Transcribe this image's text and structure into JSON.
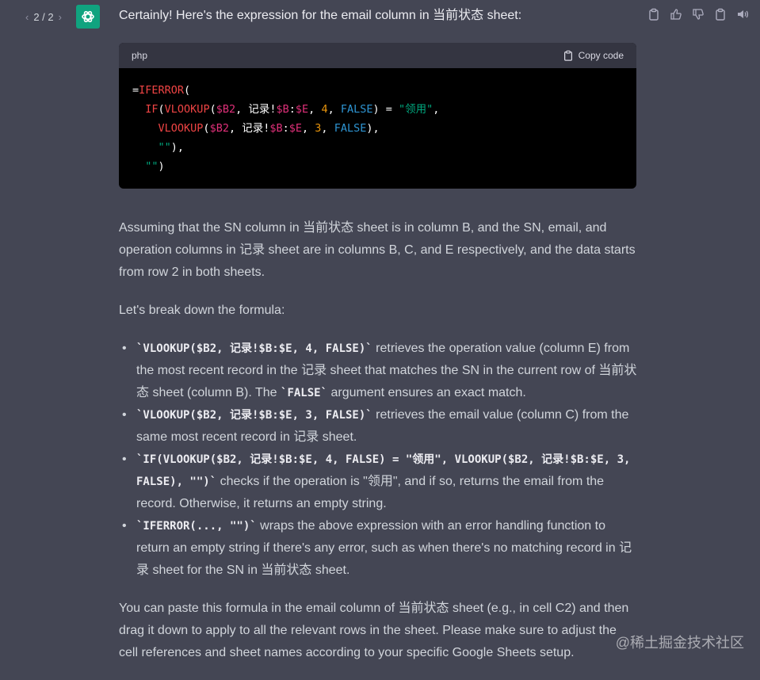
{
  "header": {
    "pager": "2 / 2",
    "prev": "‹",
    "next": "›"
  },
  "intro": "Certainly! Here's the expression for the email column in 当前状态 sheet:",
  "code_block": {
    "language": "php",
    "copy_label": "Copy code",
    "lines": [
      [
        {
          "t": "=",
          "c": "pl"
        },
        {
          "t": "IFERROR",
          "c": "kw"
        },
        {
          "t": "(",
          "c": "pl"
        }
      ],
      [
        {
          "t": "  ",
          "c": "pl"
        },
        {
          "t": "IF",
          "c": "kw"
        },
        {
          "t": "(",
          "c": "pl"
        },
        {
          "t": "VLOOKUP",
          "c": "kw"
        },
        {
          "t": "(",
          "c": "pl"
        },
        {
          "t": "$B2",
          "c": "var"
        },
        {
          "t": ", 记录!",
          "c": "pl"
        },
        {
          "t": "$B",
          "c": "var"
        },
        {
          "t": ":",
          "c": "pl"
        },
        {
          "t": "$E",
          "c": "var"
        },
        {
          "t": ", ",
          "c": "pl"
        },
        {
          "t": "4",
          "c": "num"
        },
        {
          "t": ", ",
          "c": "pl"
        },
        {
          "t": "FALSE",
          "c": "const"
        },
        {
          "t": ") = ",
          "c": "pl"
        },
        {
          "t": "\"领用\"",
          "c": "str"
        },
        {
          "t": ",",
          "c": "pl"
        }
      ],
      [
        {
          "t": "    ",
          "c": "pl"
        },
        {
          "t": "VLOOKUP",
          "c": "kw"
        },
        {
          "t": "(",
          "c": "pl"
        },
        {
          "t": "$B2",
          "c": "var"
        },
        {
          "t": ", 记录!",
          "c": "pl"
        },
        {
          "t": "$B",
          "c": "var"
        },
        {
          "t": ":",
          "c": "pl"
        },
        {
          "t": "$E",
          "c": "var"
        },
        {
          "t": ", ",
          "c": "pl"
        },
        {
          "t": "3",
          "c": "num"
        },
        {
          "t": ", ",
          "c": "pl"
        },
        {
          "t": "FALSE",
          "c": "const"
        },
        {
          "t": "),",
          "c": "pl"
        }
      ],
      [
        {
          "t": "    ",
          "c": "pl"
        },
        {
          "t": "\"\"",
          "c": "str"
        },
        {
          "t": "),",
          "c": "pl"
        }
      ],
      [
        {
          "t": "  ",
          "c": "pl"
        },
        {
          "t": "\"\"",
          "c": "str"
        },
        {
          "t": ")",
          "c": "pl"
        }
      ]
    ]
  },
  "para1": "Assuming that the SN column in 当前状态 sheet is in column B, and the SN, email, and operation columns in 记录 sheet are in columns B, C, and E respectively, and the data starts from row 2 in both sheets.",
  "para2": "Let's break down the formula:",
  "bullets": [
    {
      "code": "`VLOOKUP($B2, 记录!$B:$E, 4, FALSE)`",
      "text": " retrieves the operation value (column E) from the most recent record in the 记录 sheet that matches the SN in the current row of 当前状态 sheet (column B). The ",
      "code2": "`FALSE`",
      "text2": " argument ensures an exact match."
    },
    {
      "code": "`VLOOKUP($B2, 记录!$B:$E, 3, FALSE)`",
      "text": " retrieves the email value (column C) from the same most recent record in 记录 sheet.",
      "code2": "",
      "text2": ""
    },
    {
      "code": "`IF(VLOOKUP($B2, 记录!$B:$E, 4, FALSE) = \"领用\", VLOOKUP($B2, 记录!$B:$E, 3, FALSE), \"\")`",
      "text": " checks if the operation is \"领用\", and if so, returns the email from the record. Otherwise, it returns an empty string.",
      "code2": "",
      "text2": ""
    },
    {
      "code": "`IFERROR(..., \"\")`",
      "text": " wraps the above expression with an error handling function to return an empty string if there's any error, such as when there's no matching record in 记录 sheet for the SN in 当前状态 sheet.",
      "code2": "",
      "text2": ""
    }
  ],
  "para3": "You can paste this formula in the email column of 当前状态 sheet (e.g., in cell C2) and then drag it down to apply to all the relevant rows in the sheet. Please make sure to adjust the cell references and sheet names according to your specific Google Sheets setup.",
  "watermark": "@稀土掘金技术社区",
  "icons": [
    "openai-logo-icon",
    "clipboard-icon",
    "thumbs-up-icon",
    "thumbs-down-icon",
    "clipboard-icon",
    "speaker-icon"
  ]
}
